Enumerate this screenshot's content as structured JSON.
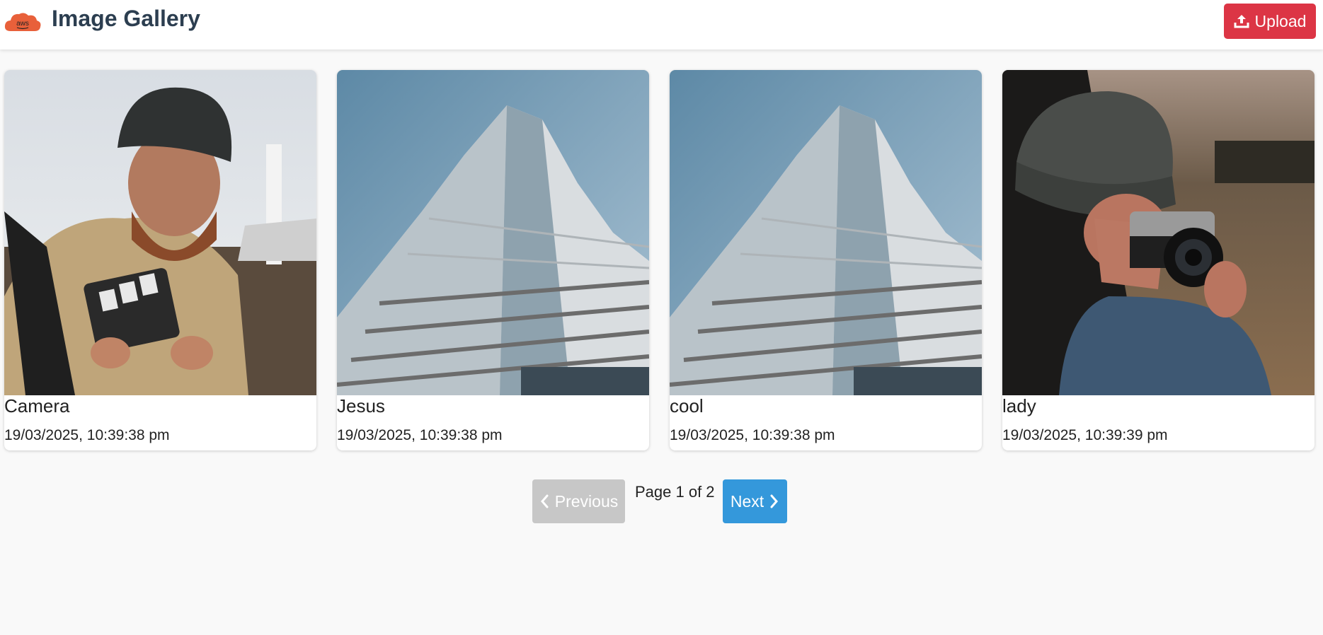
{
  "header": {
    "logo_text": "aws",
    "title": "Image Gallery",
    "upload_label": "Upload"
  },
  "gallery": {
    "items": [
      {
        "caption": "Camera",
        "date": "19/03/2025, 10:39:38 pm",
        "image": "man-with-beanie-film-case"
      },
      {
        "caption": "Jesus",
        "date": "19/03/2025, 10:39:38 pm",
        "image": "skyscraper-low-angle"
      },
      {
        "caption": "cool",
        "date": "19/03/2025, 10:39:38 pm",
        "image": "skyscraper-low-angle"
      },
      {
        "caption": "lady",
        "date": "19/03/2025, 10:39:39 pm",
        "image": "woman-with-camera"
      }
    ]
  },
  "pagination": {
    "previous_label": "Previous",
    "page_info": "Page 1 of 2",
    "next_label": "Next",
    "previous_disabled": true
  },
  "colors": {
    "upload": "#dc3545",
    "next": "#3498db",
    "previous_disabled": "#c7c7c7",
    "title": "#2c3e50"
  }
}
